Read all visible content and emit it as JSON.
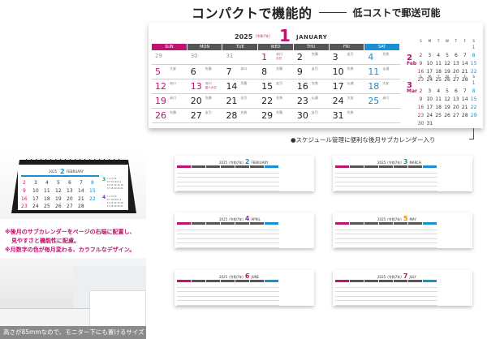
{
  "headline": {
    "main": "コンパクトで機能的",
    "sub": "低コストで郵送可能"
  },
  "main_calendar": {
    "year": "2025",
    "era": "[令和7年]",
    "month_num": "1",
    "month_name": "JANUARY",
    "dow": [
      "SUN",
      "MON",
      "TUE",
      "WED",
      "THU",
      "FRI",
      "SAT"
    ],
    "weeks": [
      [
        {
          "n": "29",
          "c": "grey"
        },
        {
          "n": "30",
          "c": "grey"
        },
        {
          "n": "31",
          "c": "grey"
        },
        {
          "n": "1",
          "c": "red",
          "r": "赤口",
          "h": "元日"
        },
        {
          "n": "2",
          "c": "",
          "r": "先勝"
        },
        {
          "n": "3",
          "c": "",
          "r": "友引"
        },
        {
          "n": "4",
          "c": "blue",
          "r": "先負"
        }
      ],
      [
        {
          "n": "5",
          "c": "red",
          "r": "大安"
        },
        {
          "n": "6",
          "c": "",
          "r": "先勝"
        },
        {
          "n": "7",
          "c": "",
          "r": "赤口"
        },
        {
          "n": "8",
          "c": "",
          "r": "先勝"
        },
        {
          "n": "9",
          "c": "",
          "r": "友引"
        },
        {
          "n": "10",
          "c": "",
          "r": "先負"
        },
        {
          "n": "11",
          "c": "blue",
          "r": "仏滅"
        }
      ],
      [
        {
          "n": "12",
          "c": "red",
          "r": "赤口"
        },
        {
          "n": "13",
          "c": "red",
          "r": "赤口",
          "h": "成人の日"
        },
        {
          "n": "14",
          "c": "",
          "r": "先勝"
        },
        {
          "n": "15",
          "c": "",
          "r": "友引"
        },
        {
          "n": "16",
          "c": "",
          "r": "先負"
        },
        {
          "n": "17",
          "c": "",
          "r": "仏滅"
        },
        {
          "n": "18",
          "c": "blue",
          "r": "大安"
        }
      ],
      [
        {
          "n": "19",
          "c": "red",
          "r": "赤口"
        },
        {
          "n": "20",
          "c": "",
          "r": "先勝"
        },
        {
          "n": "21",
          "c": "",
          "r": "友引"
        },
        {
          "n": "22",
          "c": "",
          "r": "先負"
        },
        {
          "n": "23",
          "c": "",
          "r": "仏滅"
        },
        {
          "n": "24",
          "c": "",
          "r": "大安"
        },
        {
          "n": "25",
          "c": "blue",
          "r": "赤口"
        }
      ],
      [
        {
          "n": "26",
          "c": "red",
          "r": "先勝"
        },
        {
          "n": "27",
          "c": "",
          "r": "友引"
        },
        {
          "n": "28",
          "c": "",
          "r": "先負"
        },
        {
          "n": "29",
          "c": "",
          "r": "先勝"
        },
        {
          "n": "30",
          "c": "",
          "r": "友引"
        },
        {
          "n": "31",
          "c": "",
          "r": "先負"
        },
        {
          "n": "",
          "c": ""
        }
      ]
    ]
  },
  "mini_feb": {
    "num": "2",
    "name": "Feb",
    "dow": [
      "S",
      "M",
      "T",
      "W",
      "T",
      "F",
      "S"
    ],
    "rows": [
      [
        "",
        "",
        "",
        "",
        "",
        "",
        "1"
      ],
      [
        "2",
        "3",
        "4",
        "5",
        "6",
        "7",
        "8"
      ],
      [
        "9",
        "10",
        "11",
        "12",
        "13",
        "14",
        "15"
      ],
      [
        "16",
        "17",
        "18",
        "19",
        "20",
        "21",
        "22"
      ],
      [
        "23",
        "24",
        "25",
        "26",
        "27",
        "28",
        ""
      ]
    ]
  },
  "mini_mar": {
    "num": "3",
    "name": "Mar",
    "dow": [
      "S",
      "M",
      "T",
      "W",
      "T",
      "F",
      "S"
    ],
    "rows": [
      [
        "",
        "",
        "",
        "",
        "",
        "",
        "1"
      ],
      [
        "2",
        "3",
        "4",
        "5",
        "6",
        "7",
        "8"
      ],
      [
        "9",
        "10",
        "11",
        "12",
        "13",
        "14",
        "15"
      ],
      [
        "16",
        "17",
        "18",
        "19",
        "20",
        "21",
        "22"
      ],
      [
        "23",
        "24",
        "25",
        "26",
        "27",
        "28",
        "29"
      ],
      [
        "30",
        "31",
        "",
        "",
        "",
        "",
        ""
      ]
    ]
  },
  "caption_main": "●スケジュール管理に便利な後月サブカレンダー入り",
  "notes": [
    "※後月のサブカレンダーをページの右端に配置し、",
    "見やすさと機能性に配慮。",
    "※月数字の色が毎月変わる、カラフルなデザイン。"
  ],
  "footer": "高さが85mmなので、モニター下にも置けるサイズ",
  "photo_calendar": {
    "year": "2025",
    "month_num": "2",
    "month_name": "FEBRUARY"
  },
  "thumbs": [
    {
      "year": "2025",
      "era": "(令和7年)",
      "num": "2",
      "name": "FEBRUARY",
      "color": "#1a8fd1"
    },
    {
      "year": "2025",
      "era": "(令和7年)",
      "num": "3",
      "name": "MARCH",
      "color": "#2e9c5a"
    },
    {
      "year": "2025",
      "era": "(令和7年)",
      "num": "4",
      "name": "APRIL",
      "color": "#7a3aa0"
    },
    {
      "year": "2025",
      "era": "(令和7年)",
      "num": "5",
      "name": "MAY",
      "color": "#e08a10"
    },
    {
      "year": "2025",
      "era": "(令和7年)",
      "num": "6",
      "name": "JUNE",
      "color": "#c0136d"
    },
    {
      "year": "2025",
      "era": "(令和7年)",
      "num": "7",
      "name": "JULY",
      "color": "#c0136d"
    }
  ],
  "colors": {
    "sunday": "#c0136d",
    "saturday": "#1a8fd1",
    "weekday": "#555555"
  }
}
